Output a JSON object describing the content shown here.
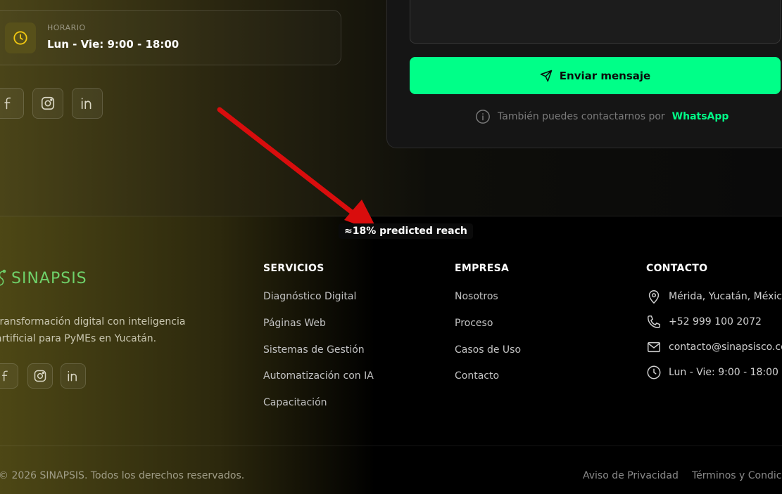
{
  "contact_card": {
    "hours_label": "HORARIO",
    "hours_value": "Lun - Vie: 9:00 - 18:00",
    "icon": "clock-icon"
  },
  "socials": [
    "facebook-icon",
    "instagram-icon",
    "linkedin-icon"
  ],
  "form": {
    "send_label": "Enviar mensaje",
    "whatsapp_prefix": "También puedes contactarnos por",
    "whatsapp_link": "WhatsApp"
  },
  "annotation": {
    "label": "≈18% predicted reach",
    "arrow_color": "#d90d0d"
  },
  "footer": {
    "brand": "SINAPSIS",
    "tagline": "transformación digital con inteligencia artificial para PyMEs en Yucatán.",
    "services": {
      "title": "SERVICIOS",
      "links": [
        "Diagnóstico Digital",
        "Páginas Web",
        "Sistemas de Gestión",
        "Automatización con IA",
        "Capacitación"
      ]
    },
    "company": {
      "title": "EMPRESA",
      "links": [
        "Nosotros",
        "Proceso",
        "Casos de Uso",
        "Contacto"
      ]
    },
    "contact": {
      "title": "CONTACTO",
      "location": "Mérida, Yucatán, México",
      "phone": "+52 999 100 2072",
      "email": "contacto@sinapsisco.com",
      "hours": "Lun - Vie: 9:00 - 18:00"
    },
    "copyright": "© 2026 SINAPSIS. Todos los derechos reservados.",
    "legal": [
      "Aviso de Privacidad",
      "Términos y Condiciones"
    ]
  },
  "colors": {
    "accent": "#00ff88",
    "brand_green": "#6fd16a",
    "olive": "#57501a"
  }
}
